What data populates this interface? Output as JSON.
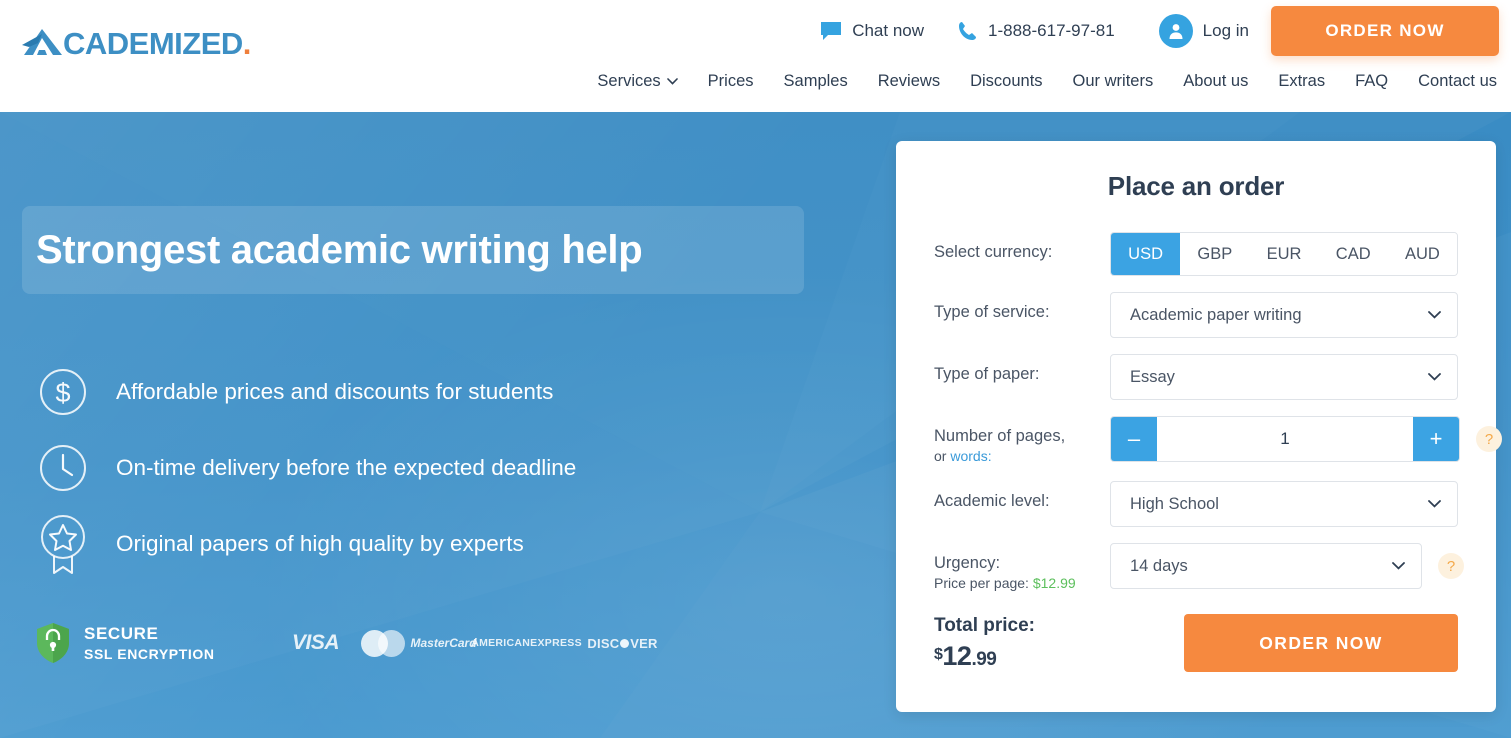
{
  "header": {
    "logo": {
      "lead": "A",
      "text": "CADEMIZED",
      "dot": "."
    },
    "chat": {
      "icon": "chat-bubble-icon",
      "label": "Chat now"
    },
    "phone": {
      "icon": "phone-icon",
      "label": "1-888-617-97-81"
    },
    "login": {
      "icon": "user-avatar-icon",
      "label": "Log in"
    },
    "order_button": "ORDER NOW",
    "nav": [
      {
        "label": "Services",
        "caret": "˅"
      },
      {
        "label": "Prices"
      },
      {
        "label": "Samples"
      },
      {
        "label": "Reviews"
      },
      {
        "label": "Discounts"
      },
      {
        "label": "Our writers"
      },
      {
        "label": "About us"
      },
      {
        "label": "Extras"
      },
      {
        "label": "FAQ"
      },
      {
        "label": "Contact us"
      }
    ]
  },
  "hero": {
    "headline": "Strongest academic writing help",
    "bullets": [
      {
        "icon": "dollar-circle-icon",
        "text": "Affordable prices and discounts for students"
      },
      {
        "icon": "clock-circle-icon",
        "text": "On-time delivery before the expected deadline"
      },
      {
        "icon": "star-badge-icon",
        "text": "Original papers of high quality by experts"
      }
    ],
    "secure": {
      "icon": "shield-lock-icon",
      "line1": "SECURE",
      "line2": "SSL ENCRYPTION"
    },
    "payments": [
      {
        "name": "visa-logo",
        "label": "VISA"
      },
      {
        "name": "mastercard-logo",
        "label": "MasterCard"
      },
      {
        "name": "amex-logo",
        "label1": "AMERICAN",
        "label2": "EXPRESS"
      },
      {
        "name": "discover-logo",
        "pre": "DISC",
        "post": "VER"
      }
    ]
  },
  "order_form": {
    "title": "Place an order",
    "currency": {
      "label": "Select currency:",
      "options": [
        "USD",
        "GBP",
        "EUR",
        "CAD",
        "AUD"
      ],
      "selected": "USD"
    },
    "service": {
      "label": "Type of service:",
      "value": "Academic paper writing"
    },
    "paper": {
      "label": "Type of paper:",
      "value": "Essay"
    },
    "pages": {
      "label_line1": "Number of pages,",
      "label_or": "or ",
      "label_link": "words:",
      "minus": "–",
      "plus": "+",
      "value": "1",
      "help": "?"
    },
    "level": {
      "label": "Academic level:",
      "value": "High School"
    },
    "urgency": {
      "label": "Urgency:",
      "sub_prefix": "Price per page: ",
      "sub_price": "$12.99",
      "value": "14 days",
      "help": "?"
    },
    "total": {
      "label": "Total price:",
      "currency_symbol": "$",
      "amount": "12",
      "cents": ".99"
    },
    "submit": "ORDER NOW"
  },
  "colors": {
    "hero_blue": "#3a8cc4",
    "accent_blue": "#3ba3e3",
    "orange": "#f6893f",
    "navy": "#2f3f53",
    "green": "#5cbf5c",
    "help_bg": "#fdf1de"
  }
}
